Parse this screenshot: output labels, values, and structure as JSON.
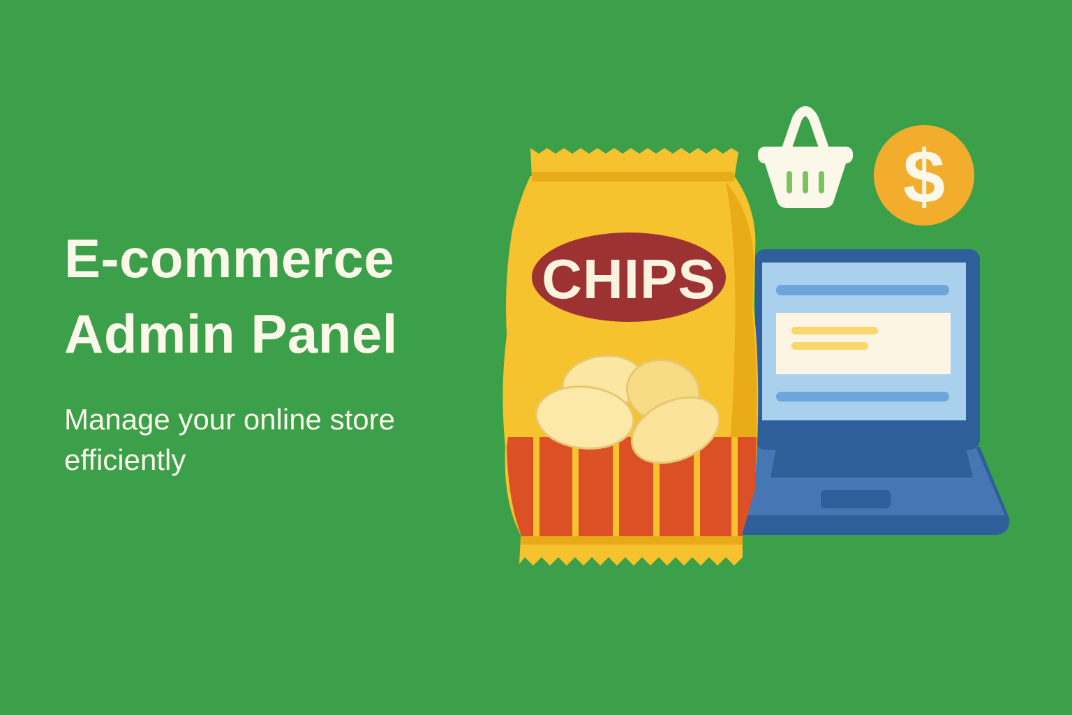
{
  "hero": {
    "title_line1": "E-commerce",
    "title_line2": "Admin Panel",
    "subtitle_line1": "Manage your online store",
    "subtitle_line2": "efficiently"
  },
  "illustration": {
    "bag_label": "CHIPS",
    "currency_symbol": "$",
    "icons": [
      "chips-bag-icon",
      "shopping-basket-icon",
      "dollar-coin-icon",
      "laptop-icon"
    ]
  },
  "colors": {
    "background": "#3c9f4a",
    "text": "#fbf8e9",
    "bag_yellow": "#f6c22e",
    "bag_red_band": "#dc5026",
    "label_maroon": "#9c3232",
    "coin_orange": "#f2ad2c",
    "laptop_blue": "#3f72b0"
  }
}
